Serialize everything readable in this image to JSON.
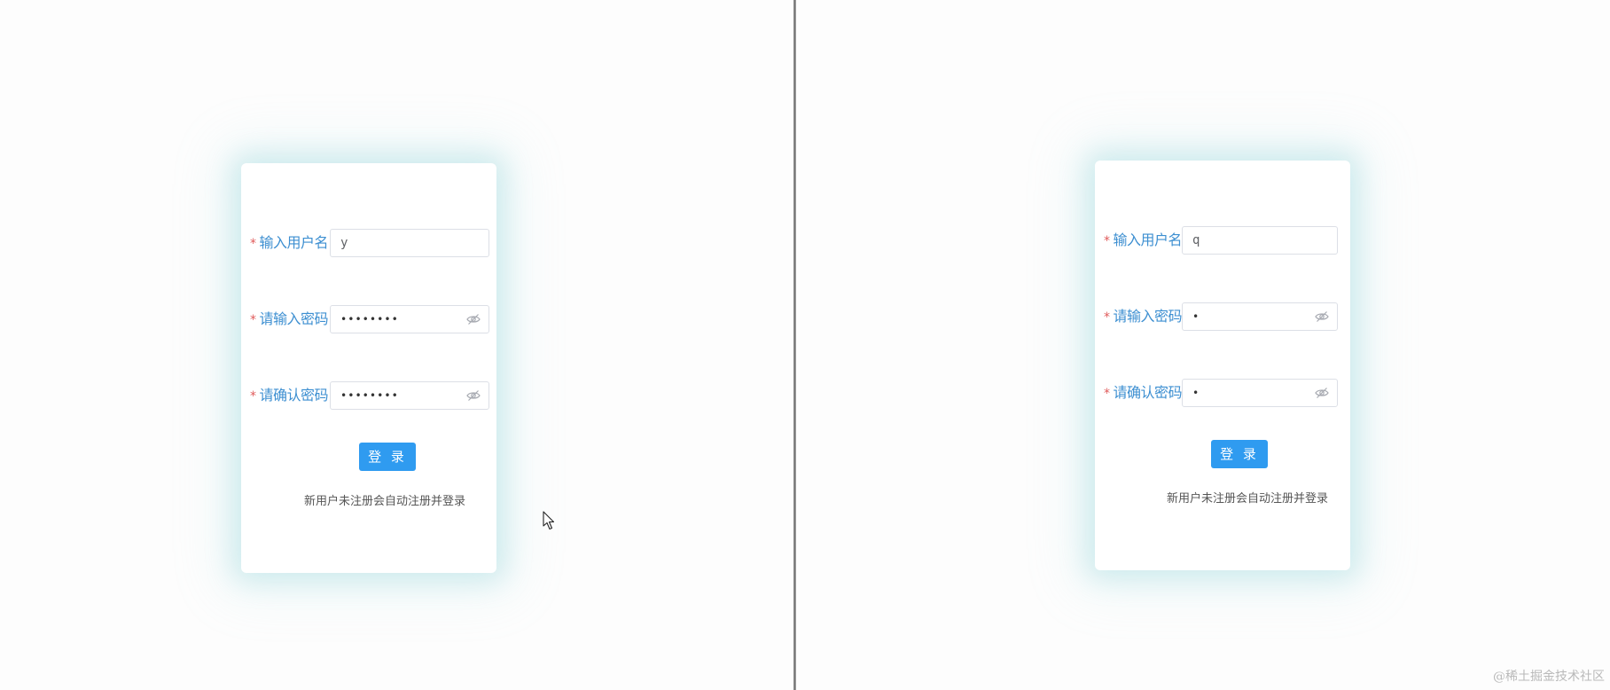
{
  "left_form": {
    "username_label": "输入用户名",
    "username_value": "y",
    "password_label": "请输入密码",
    "password_value": "••••••••",
    "confirm_label": "请确认密码",
    "confirm_value": "••••••••",
    "login_label": "登 录",
    "hint": "新用户未注册会自动注册并登录"
  },
  "right_form": {
    "username_label": "输入用户名",
    "username_value": "q",
    "password_label": "请输入密码",
    "password_value": "•",
    "confirm_label": "请确认密码",
    "confirm_value": "•",
    "login_label": "登 录",
    "hint": "新用户未注册会自动注册并登录"
  },
  "required_marker": "*",
  "watermark": "@稀土掘金技术社区",
  "colors": {
    "label": "#3d8fd1",
    "required": "#e05a5a",
    "button": "#2f9bf0",
    "card_glow": "#a0dce1"
  },
  "icons": {
    "password_toggle": "eye-slash-icon",
    "cursor": "mouse-pointer-icon"
  }
}
